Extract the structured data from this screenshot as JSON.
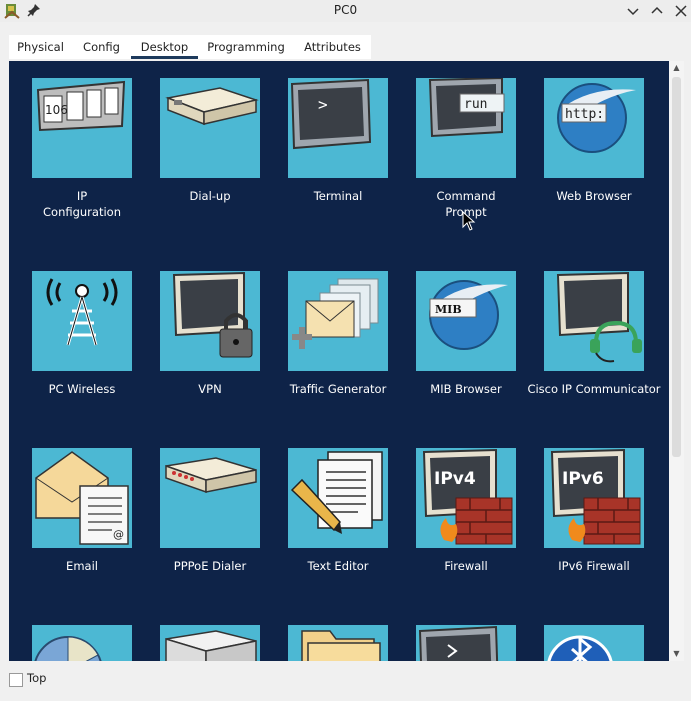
{
  "window": {
    "title": "PC0"
  },
  "tabs": [
    {
      "label": "Physical"
    },
    {
      "label": "Config"
    },
    {
      "label": "Desktop",
      "active": true
    },
    {
      "label": "Programming"
    },
    {
      "label": "Attributes"
    }
  ],
  "apps": [
    {
      "label": "IP\nConfiguration",
      "icon": "ip-configuration-icon",
      "icon_text": "106"
    },
    {
      "label": "Dial-up",
      "icon": "modem-icon"
    },
    {
      "label": "Terminal",
      "icon": "terminal-icon",
      "icon_text": ">"
    },
    {
      "label": "Command\nPrompt",
      "icon": "command-prompt-icon",
      "icon_text": "run"
    },
    {
      "label": "Web Browser",
      "icon": "web-browser-icon",
      "icon_text": "http:"
    },
    {
      "label": "PC Wireless",
      "icon": "wireless-tower-icon"
    },
    {
      "label": "VPN",
      "icon": "vpn-lock-icon"
    },
    {
      "label": "Traffic Generator",
      "icon": "traffic-generator-icon"
    },
    {
      "label": "MIB Browser",
      "icon": "mib-browser-icon",
      "icon_text": "MIB"
    },
    {
      "label": "Cisco IP Communicator",
      "icon": "ip-communicator-headset-icon"
    },
    {
      "label": "Email",
      "icon": "email-icon"
    },
    {
      "label": "PPPoE Dialer",
      "icon": "pppoe-dialer-icon"
    },
    {
      "label": "Text Editor",
      "icon": "text-editor-icon"
    },
    {
      "label": "Firewall",
      "icon": "firewall-icon",
      "icon_text": "IPv4"
    },
    {
      "label": "IPv6 Firewall",
      "icon": "ipv6-firewall-icon",
      "icon_text": "IPv6"
    }
  ],
  "partial_row_icons": [
    "pie-chart-icon",
    "device-box-icon",
    "folder-icon",
    "terminal-icon",
    "bluetooth-icon"
  ],
  "footer": {
    "top_label": "Top",
    "top_checked": false
  }
}
